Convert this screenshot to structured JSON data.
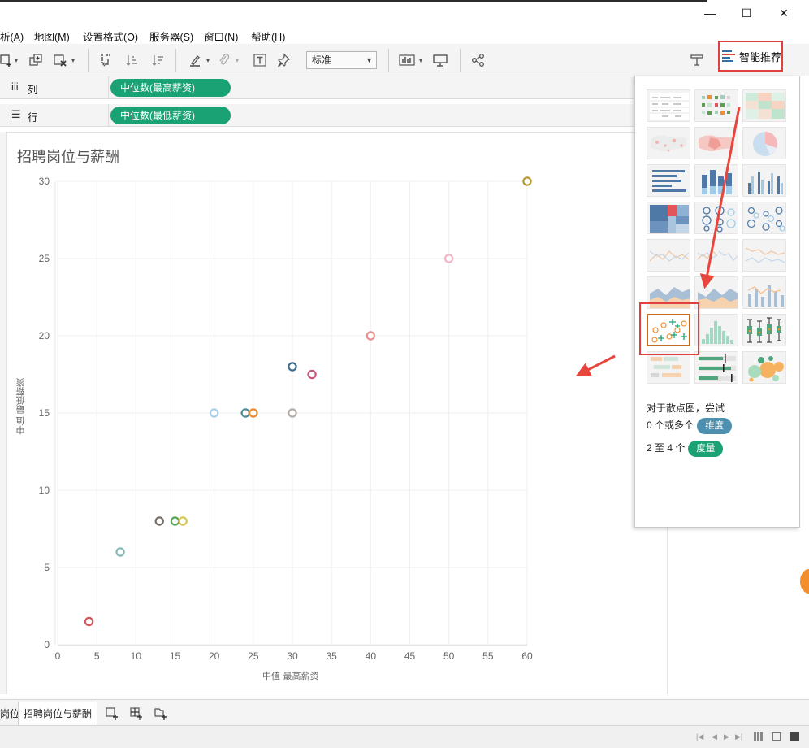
{
  "window": {
    "minimize_glyph": "—",
    "maximize_glyph": "☐",
    "close_glyph": "✕"
  },
  "menu": [
    "析(A)",
    "地图(M)",
    "设置格式(O)",
    "服务器(S)",
    "窗口(N)",
    "帮助(H)"
  ],
  "toolbar": {
    "mark_label_select": "标准",
    "smart_show_label": "智能推荐"
  },
  "shelves": {
    "columns_label": "列",
    "columns_pill": "中位数(最高薪资)",
    "rows_label": "行",
    "rows_pill": "中位数(最低薪资)"
  },
  "sheet": {
    "title": "招聘岗位与薪酬"
  },
  "chart_data": {
    "type": "scatter",
    "title": "招聘岗位与薪酬",
    "xlabel": "中值 最高薪资",
    "ylabel": "中值 最低薪资",
    "xlim": [
      0,
      60
    ],
    "ylim": [
      0,
      30
    ],
    "xticks": [
      0,
      5,
      10,
      15,
      20,
      25,
      30,
      35,
      40,
      45,
      50,
      55,
      60
    ],
    "yticks": [
      0,
      5,
      10,
      15,
      20,
      25,
      30
    ],
    "grid": true,
    "points": [
      {
        "x": 4,
        "y": 1.5,
        "color": "#d6545b"
      },
      {
        "x": 8,
        "y": 6,
        "color": "#86b7b9"
      },
      {
        "x": 13,
        "y": 8,
        "color": "#7a6e6a"
      },
      {
        "x": 15,
        "y": 8,
        "color": "#5aa35a"
      },
      {
        "x": 16,
        "y": 8,
        "color": "#d8c651"
      },
      {
        "x": 20,
        "y": 15,
        "color": "#a9d0ea"
      },
      {
        "x": 24,
        "y": 15,
        "color": "#4c8a8e"
      },
      {
        "x": 25,
        "y": 15,
        "color": "#ec8a2e"
      },
      {
        "x": 30,
        "y": 15,
        "color": "#b5aca6"
      },
      {
        "x": 30,
        "y": 18,
        "color": "#3d6e8e"
      },
      {
        "x": 32.5,
        "y": 17.5,
        "color": "#c9577b"
      },
      {
        "x": 40,
        "y": 20,
        "color": "#eb8f8e"
      },
      {
        "x": 50,
        "y": 25,
        "color": "#f2b4c3"
      },
      {
        "x": 60,
        "y": 30,
        "color": "#b49a2b"
      }
    ]
  },
  "smart_show": {
    "hint_title": "对于散点图，尝试",
    "dim_prefix": "0 个或多个",
    "dim_badge": "维度",
    "meas_prefix": "2 至 4 个",
    "meas_badge": "度量"
  },
  "tabs": {
    "prev_partial": "岗位",
    "active": "招聘岗位与薪酬"
  },
  "colors": {
    "pill_green": "#1aa174",
    "dimension_blue": "#4d8fae",
    "highlight_red": "#e04040"
  }
}
